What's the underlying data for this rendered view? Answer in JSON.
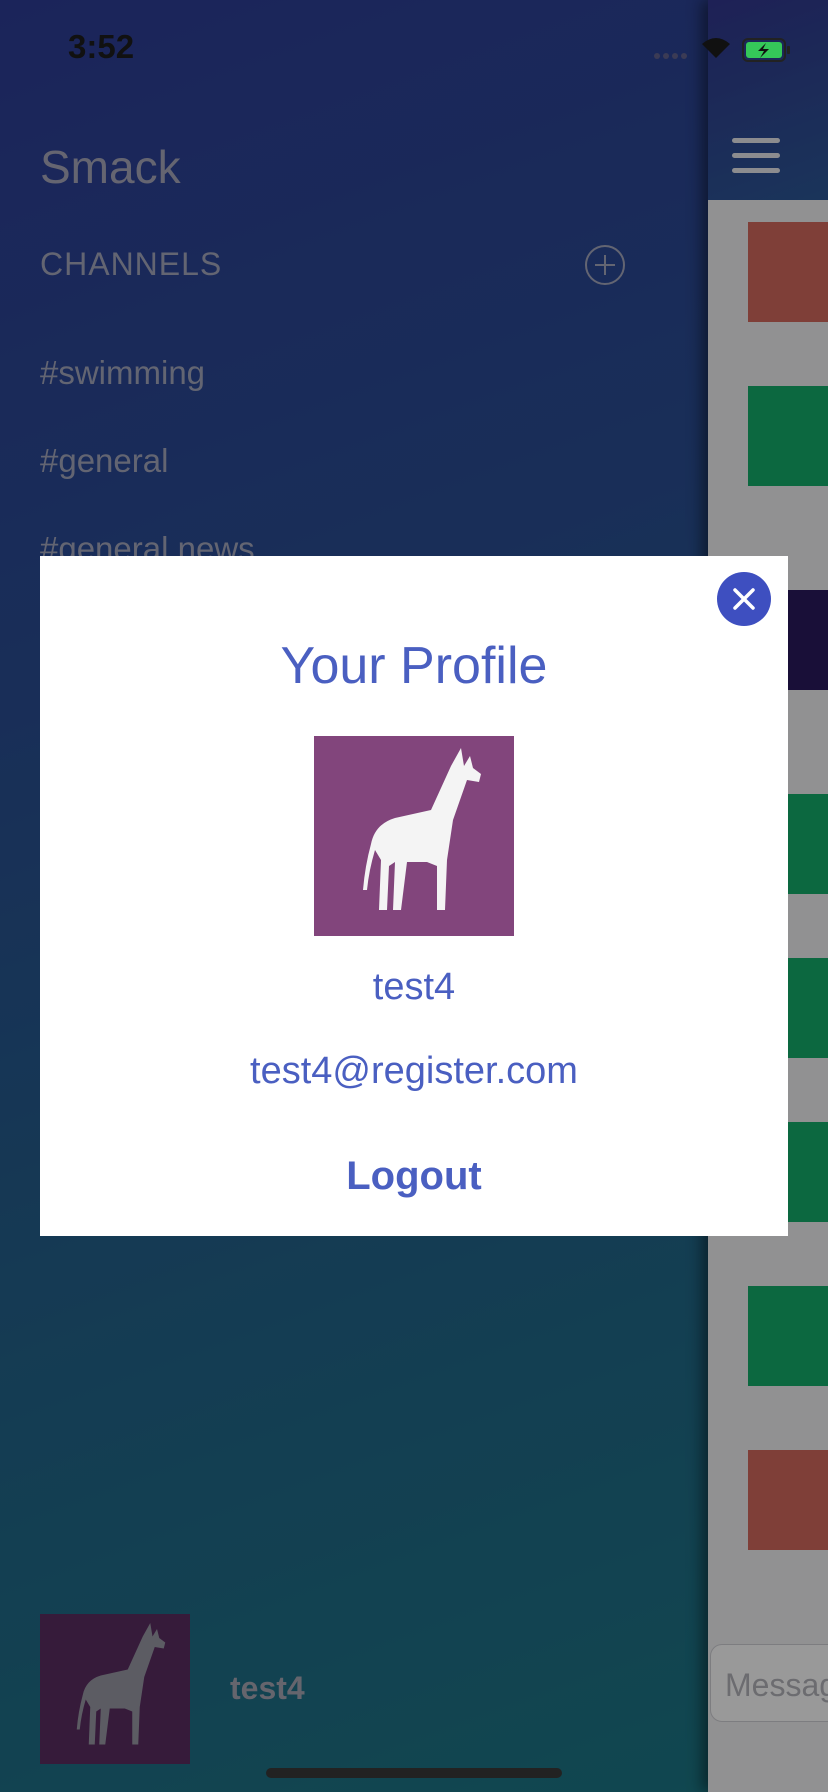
{
  "status_bar": {
    "time": "3:52"
  },
  "menu": {
    "app_title": "Smack",
    "channels_header": "CHANNELS",
    "channels": [
      "#swimming",
      "#general",
      "#general news"
    ],
    "user_name": "test4"
  },
  "chat": {
    "message_placeholder": "Message"
  },
  "profile_modal": {
    "title": "Your Profile",
    "user_name": "test4",
    "email": "test4@register.com",
    "logout_label": "Logout"
  },
  "colors": {
    "accent": "#4a5fc1",
    "close_button": "#3e4fc0",
    "profile_avatar_bg": "#82457c",
    "menu_gradient_start": "#2e3d97",
    "menu_gradient_end": "#1c7785"
  }
}
